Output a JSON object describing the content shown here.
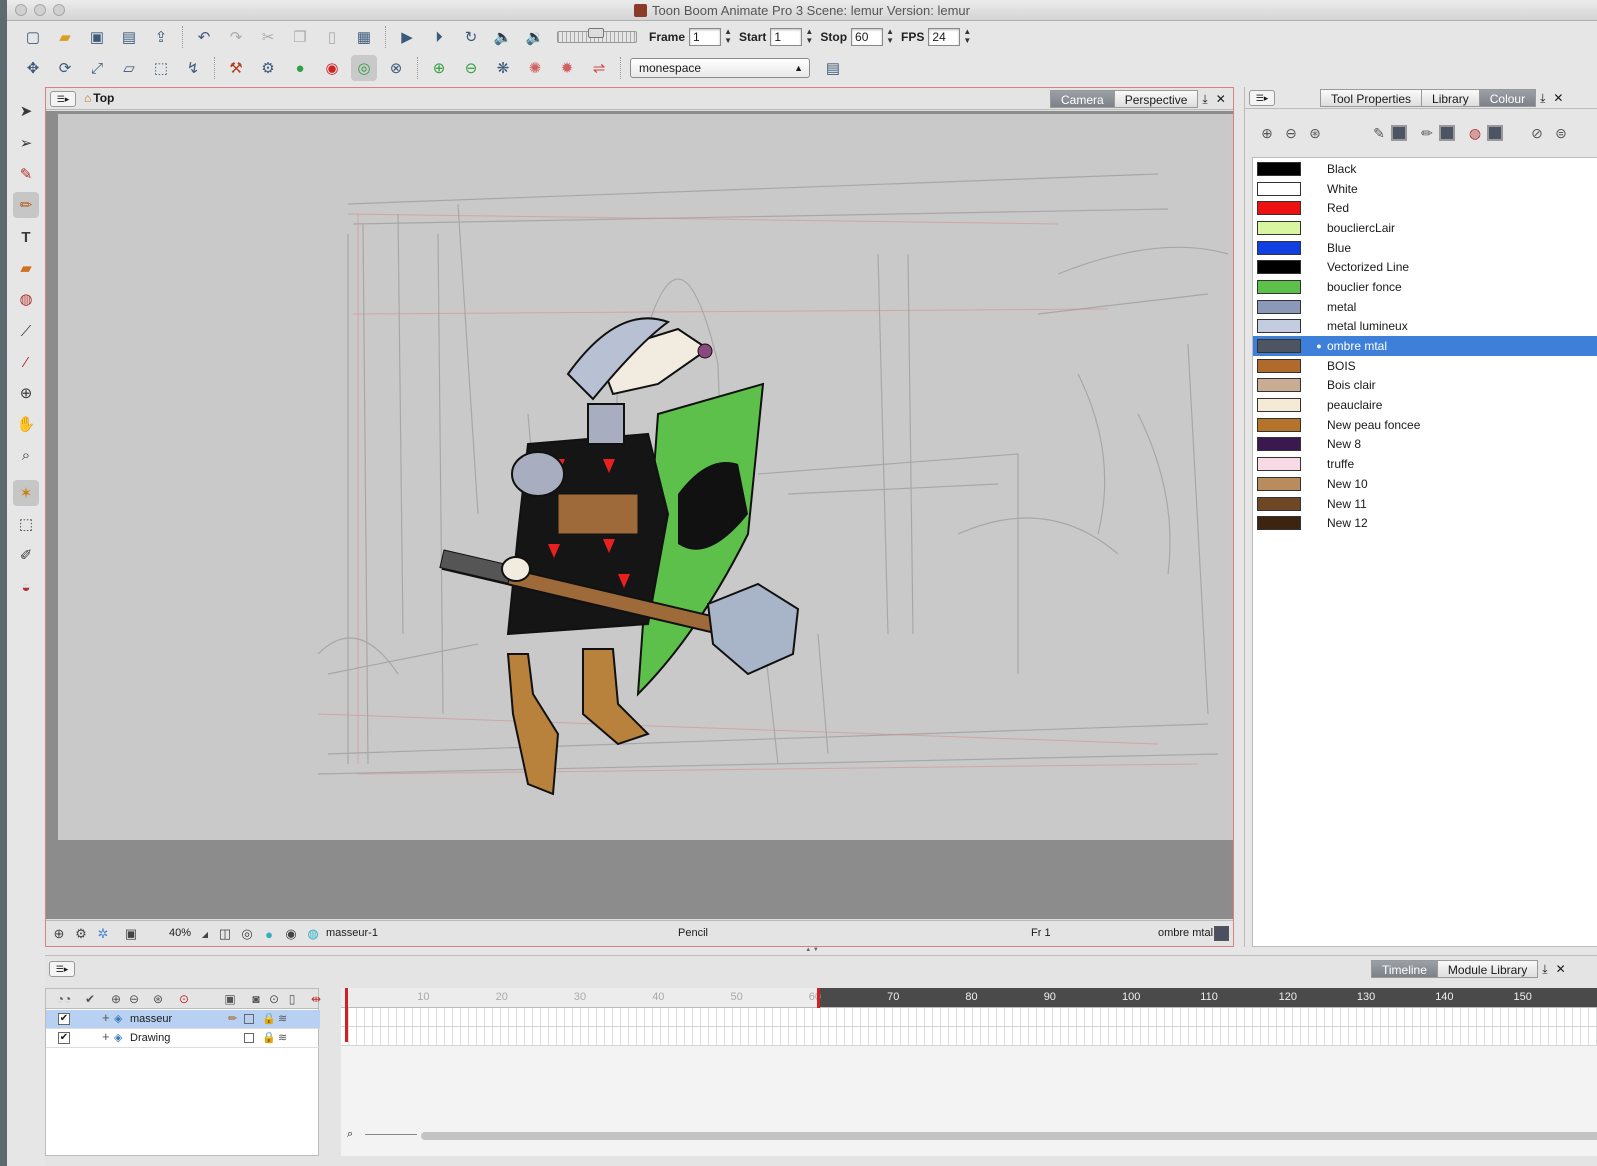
{
  "window": {
    "title": "Toon Boom Animate Pro 3 Scene: lemur Version: lemur"
  },
  "toolbar": {
    "frame_label": "Frame",
    "frame_value": "1",
    "start_label": "Start",
    "start_value": "1",
    "stop_label": "Stop",
    "stop_value": "60",
    "fps_label": "FPS",
    "fps_value": "24",
    "workspace_value": "monespace"
  },
  "camera_view": {
    "view_name": "Top",
    "tabs": [
      "Camera",
      "Perspective"
    ],
    "active_tab": "Camera",
    "footer": {
      "zoom": "40%",
      "drawing_name": "masseur-1",
      "tool_name": "Pencil",
      "frame": "Fr 1",
      "current_colour": "ombre mtal"
    }
  },
  "right_panel": {
    "tabs": [
      "Tool Properties",
      "Library",
      "Colour"
    ],
    "active_tab": "Colour",
    "colours": [
      {
        "name": "Black",
        "color": "#000000"
      },
      {
        "name": "White",
        "color": "#ffffff"
      },
      {
        "name": "Red",
        "color": "#ee1111"
      },
      {
        "name": "boucliercLair",
        "color": "#d8f5a0"
      },
      {
        "name": "Blue",
        "color": "#1040e0"
      },
      {
        "name": "Vectorized Line",
        "color": "#000000"
      },
      {
        "name": "bouclier fonce",
        "color": "#5cc04a"
      },
      {
        "name": "metal",
        "color": "#8c98b8"
      },
      {
        "name": "metal lumineux",
        "color": "#c4cce0"
      },
      {
        "name": "ombre mtal",
        "color": "#4d5462",
        "selected": true
      },
      {
        "name": "BOIS",
        "color": "#b06a2c"
      },
      {
        "name": "Bois clair",
        "color": "#c8ac94"
      },
      {
        "name": "peauclaire",
        "color": "#f5ead6"
      },
      {
        "name": "New peau foncee",
        "color": "#b4742c"
      },
      {
        "name": "New 8",
        "color": "#3c1850"
      },
      {
        "name": "truffe",
        "color": "#f8dae4"
      },
      {
        "name": "New 10",
        "color": "#b88c5c"
      },
      {
        "name": "New 11",
        "color": "#6e4824"
      },
      {
        "name": "New 12",
        "color": "#3c2410"
      }
    ]
  },
  "timeline": {
    "tabs": [
      "Timeline",
      "Module Library"
    ],
    "active_tab": "Timeline",
    "layers": [
      {
        "name": "masseur",
        "selected": true
      },
      {
        "name": "Drawing",
        "selected": false
      }
    ],
    "ruler_ticks": [
      "10",
      "20",
      "30",
      "40",
      "50",
      "60",
      "70",
      "80",
      "90",
      "100",
      "110",
      "120",
      "130",
      "140",
      "150"
    ],
    "current_frame": 1,
    "stop_frame": 60
  }
}
